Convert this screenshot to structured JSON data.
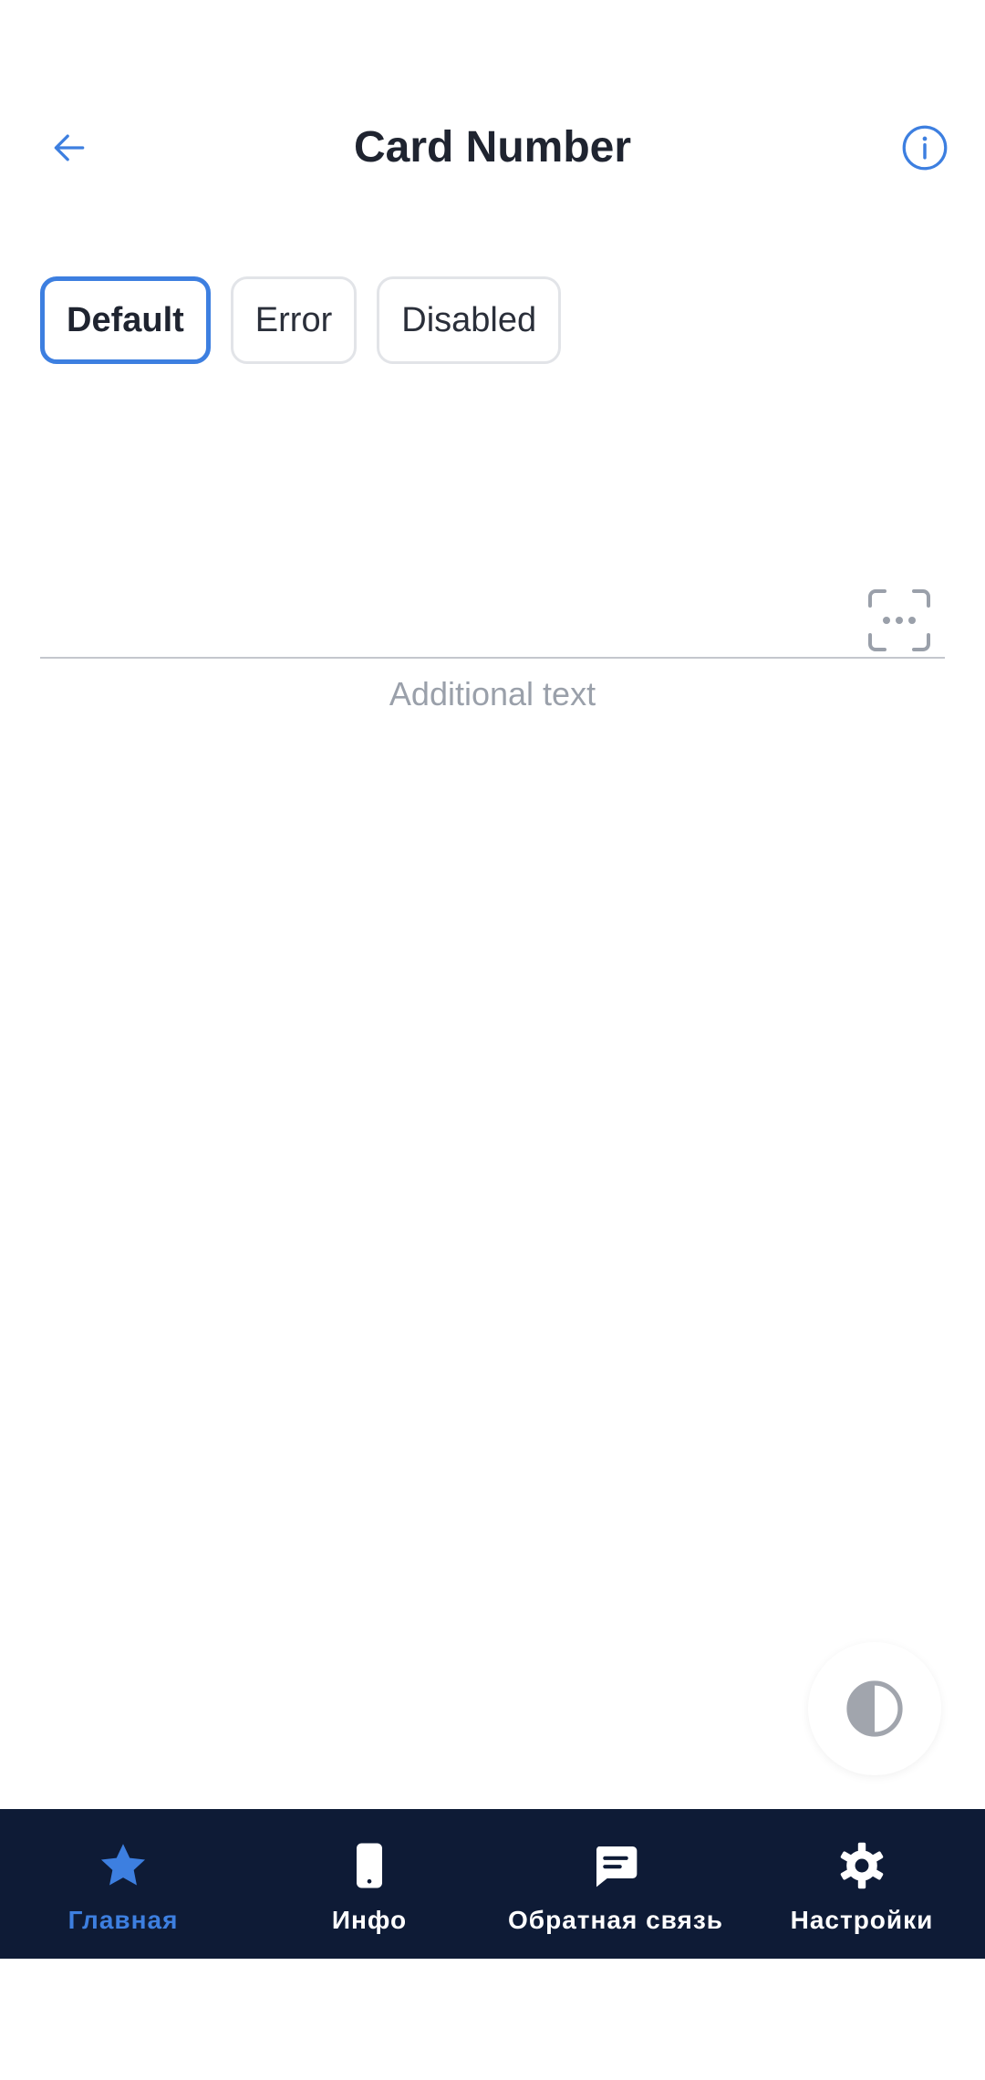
{
  "header": {
    "title": "Card Number",
    "back_icon": "arrow-left-icon",
    "info_icon": "info-circle-icon"
  },
  "chips": [
    {
      "label": "Default",
      "selected": true
    },
    {
      "label": "Error",
      "selected": false
    },
    {
      "label": "Disabled",
      "selected": false
    }
  ],
  "field": {
    "value": "",
    "placeholder": "",
    "helper_text": "Additional text",
    "scan_icon": "scan-card-icon"
  },
  "theme_toggle": {
    "icon": "contrast-icon"
  },
  "bottom_nav": {
    "items": [
      {
        "label": "Главная",
        "icon": "star-icon",
        "active": true
      },
      {
        "label": "Инфо",
        "icon": "phone-icon",
        "active": false
      },
      {
        "label": "Обратная связь",
        "icon": "chat-icon",
        "active": false
      },
      {
        "label": "Настройки",
        "icon": "gear-icon",
        "active": false
      }
    ]
  },
  "colors": {
    "accent": "#3d7fe0",
    "nav_background": "#0e1b36",
    "text": "#1f2430",
    "muted": "#9aa0aa"
  }
}
